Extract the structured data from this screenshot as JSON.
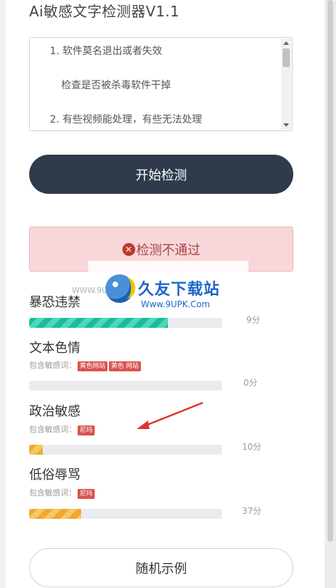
{
  "app": {
    "title": "Ai敏感文字检测器V1.1"
  },
  "textarea": {
    "lines": [
      "1. 软件莫名退出或者失效",
      "检查是否被杀毒软件干掉",
      "2. 有些视频能处理，有些无法处理"
    ]
  },
  "buttons": {
    "start": "开始检测",
    "random": "随机示例"
  },
  "result": {
    "status": "检测不通过",
    "icon": "close-circle-icon"
  },
  "words_label": "包含敏感词：",
  "categories": [
    {
      "name": "暴恐违禁",
      "tags": [],
      "progress_fraction": 0.72,
      "score": "9分",
      "fill_color": "#1abc9c"
    },
    {
      "name": "文本色情",
      "tags": [
        "黄色网站",
        "黄色 网站"
      ],
      "progress_fraction": 0.0,
      "score": "0分",
      "fill_color": "#f0a830"
    },
    {
      "name": "政治敏感",
      "tags": [
        "尼玛"
      ],
      "progress_fraction": 0.07,
      "score": "10分",
      "fill_color": "#f0a830"
    },
    {
      "name": "低俗辱骂",
      "tags": [
        "尼玛"
      ],
      "progress_fraction": 0.27,
      "score": "37分",
      "fill_color": "#f0a830"
    }
  ],
  "watermark": {
    "brand": "久友下载站",
    "url": "Www.9UPK.Com",
    "small": "WWW.9UP"
  },
  "colors": {
    "primary_button": "#2f3a4a",
    "alert_bg": "#f8d7da",
    "alert_text": "#a94442",
    "tag_bg": "#d9534f"
  }
}
